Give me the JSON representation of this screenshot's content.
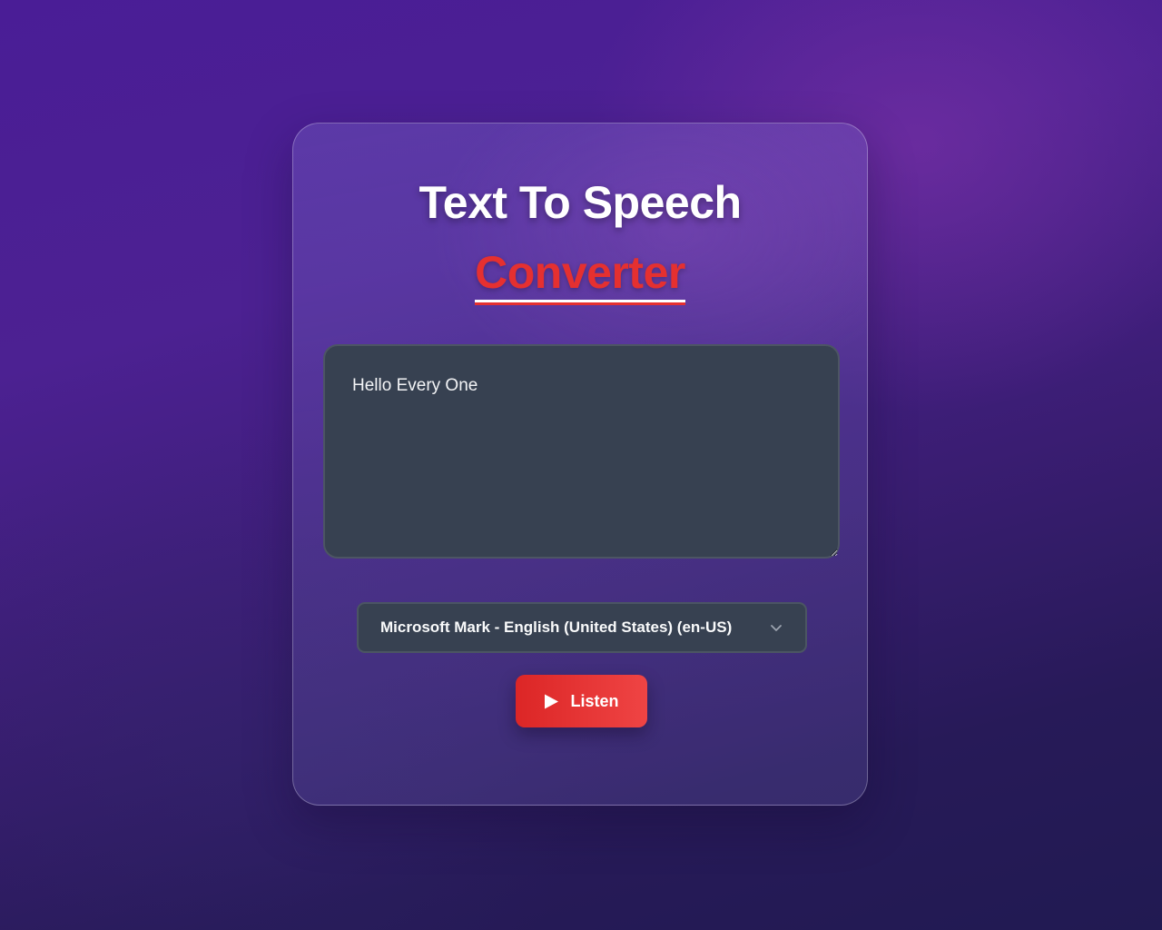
{
  "header": {
    "title": "Text To Speech",
    "subtitle": "Converter"
  },
  "editor": {
    "value": "Hello Every One",
    "placeholder": ""
  },
  "voice": {
    "selected": "Microsoft Mark - English (United States) (en-US)",
    "icon": "chevron-down-icon"
  },
  "actions": {
    "listen_label": "Listen",
    "listen_icon": "play-icon"
  },
  "colors": {
    "accent": "#e53030",
    "button_start": "#dc2626",
    "button_end": "#ef4444",
    "field_bg": "#374151"
  }
}
